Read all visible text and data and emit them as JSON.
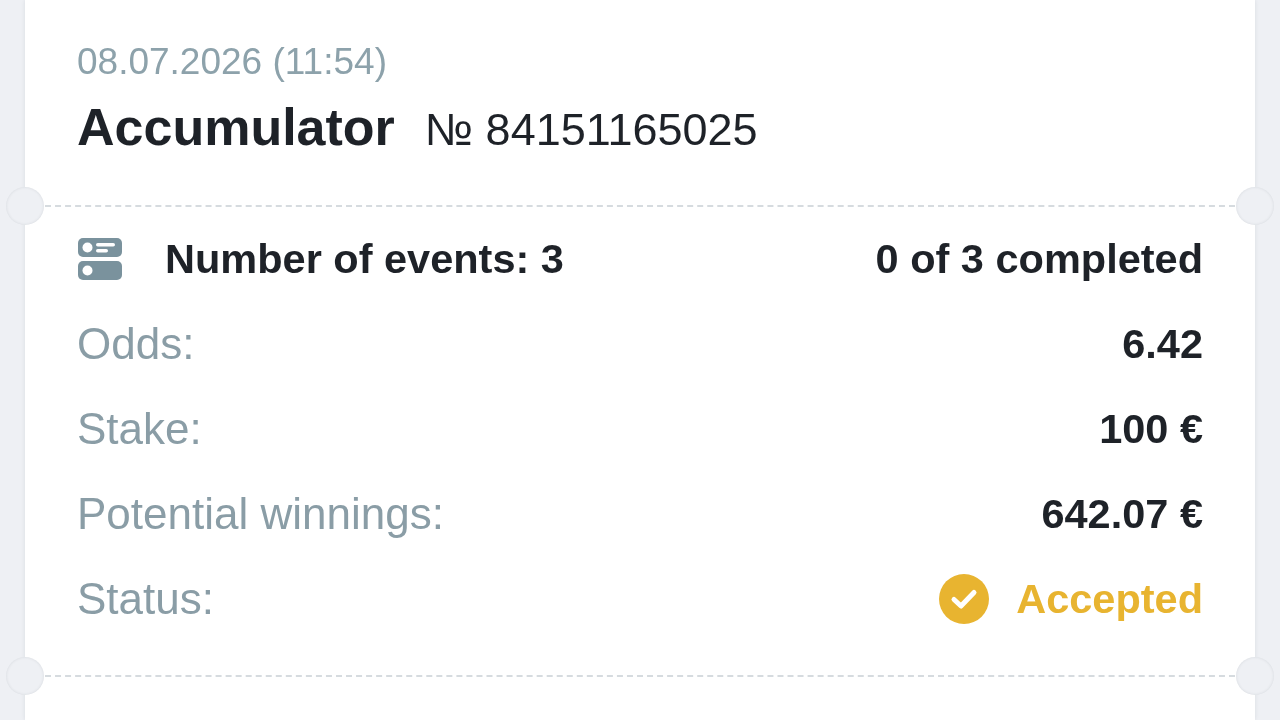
{
  "bet": {
    "date": "08.07.2026 (11:54)",
    "type": "Accumulator",
    "number": "№ 84151165025"
  },
  "summary": {
    "events_label": "Number of events: 3",
    "completed_text": "0 of 3 completed"
  },
  "details": [
    {
      "kind": "value",
      "label": "Odds:",
      "value": "6.42"
    },
    {
      "kind": "value",
      "label": "Stake:",
      "value": "100 €"
    },
    {
      "kind": "value",
      "label": "Potential winnings:",
      "value": "642.07 €"
    },
    {
      "kind": "status",
      "label": "Status:",
      "value": "Accepted",
      "color": "#e8b430"
    }
  ]
}
